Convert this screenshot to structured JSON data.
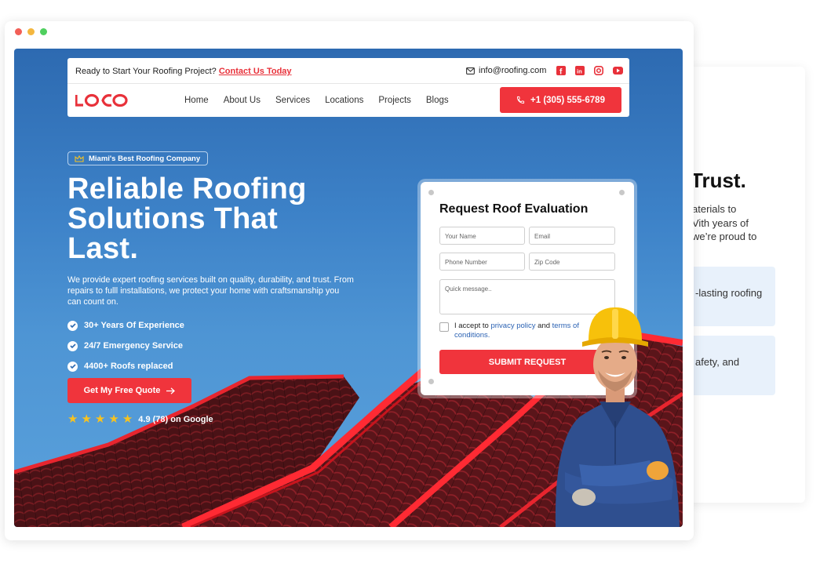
{
  "back_card": {
    "title": "Trust.",
    "lines": [
      "aterials to",
      "Vith years of",
      " we’re proud to"
    ],
    "box1": "-lasting roofing",
    "box2": "afety, and"
  },
  "window": {
    "dot_colors": [
      "#f25f57",
      "#f4b73f",
      "#4fcf5e"
    ]
  },
  "topbar": {
    "promo_text": "Ready to Start Your Roofing Project?",
    "promo_link": "Contact Us Today",
    "email": "info@roofing.com",
    "social_icons": [
      "facebook-icon",
      "linkedin-icon",
      "instagram-icon",
      "youtube-icon"
    ]
  },
  "nav": {
    "logo": "LOGO",
    "items": [
      "Home",
      "About Us",
      "Services",
      "Locations",
      "Projects",
      "Blogs"
    ],
    "phone": "+1 (305) 555-6789"
  },
  "hero": {
    "badge": "Miami's Best Roofing Company",
    "title_lines": [
      "Reliable Roofing",
      "Solutions That",
      "Last."
    ],
    "description": "We provide expert roofing services built on quality, durability, and trust. From repairs to fulll installations, we protect your home with craftsmanship you can count on.",
    "features": [
      "30+ Years Of Experience",
      "24/7 Emergency Service",
      "4400+ Roofs replaced"
    ],
    "cta": "Get My Free Quote",
    "rating_text": "4.9 (78) on Google",
    "stars": 5
  },
  "form": {
    "title": "Request Roof Evaluation",
    "name_placeholder": "Your Name",
    "email_placeholder": "Email",
    "phone_placeholder": "Phone Number",
    "zip_placeholder": "Zip Code",
    "message_placeholder": "Quick message..",
    "agree_prefix": "I accept to",
    "privacy_link": "privacy policy",
    "agree_and": "and",
    "terms_link": "terms of conditions.",
    "submit": "SUBMIT REQUEST"
  },
  "colors": {
    "accent": "#f0343c",
    "hero_blue": "#3d82c8"
  }
}
